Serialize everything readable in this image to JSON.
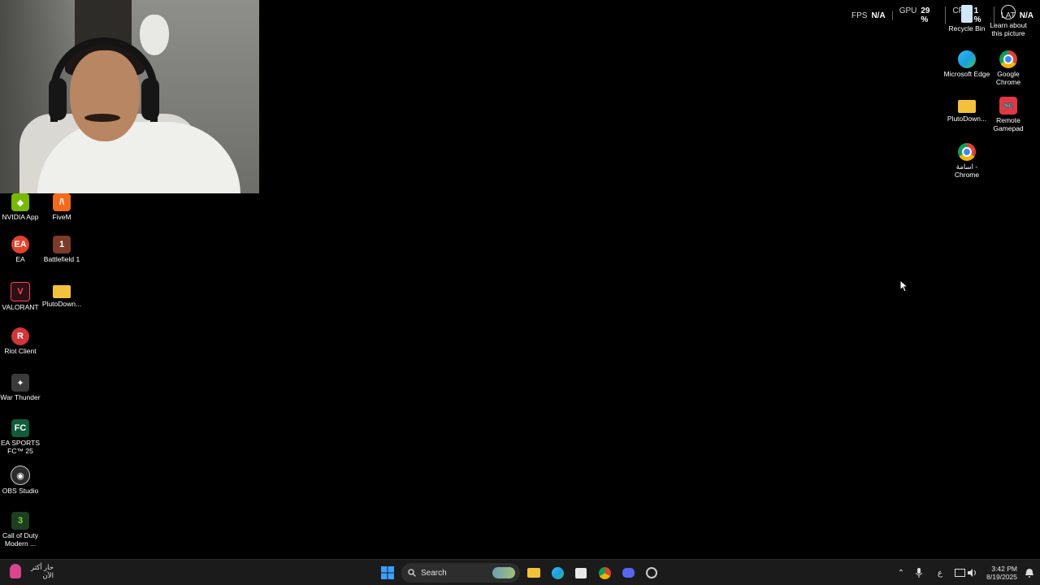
{
  "overlay": {
    "fps": {
      "key": "FPS",
      "value": "N/A"
    },
    "gpu": {
      "key": "GPU",
      "value": "29 %"
    },
    "cpu": {
      "key": "CPU",
      "value": "1 %"
    },
    "lat": {
      "key": "LAT",
      "value": "N/A"
    }
  },
  "desktop_icons": {
    "nvidia_app": "NVIDIA App",
    "fivem": "FiveM",
    "ea": "EA",
    "battlefield_1": "Battlefield 1",
    "valorant": "VALORANT",
    "pluto_left": "PlutoDown...",
    "riot_client": "Riot Client",
    "war_thunder": "War Thunder",
    "ea_sports_fc": "EA SPORTS FC™ 25",
    "obs_studio": "OBS Studio",
    "call_of_duty": "Call of Duty Modern ...",
    "recycle_bin": "Recycle Bin",
    "learn_picture": "Learn about this picture",
    "microsoft_edge": "Microsoft Edge",
    "google_chrome": "Google Chrome",
    "pluto_right": "PlutoDown...",
    "remote_gamepad": "Remote Gamepad",
    "osama_chrome": "اسامة - Chrome"
  },
  "taskbar": {
    "weather_text": "حار أكثر الآن",
    "search_label": "Search",
    "input_indicator": "ع",
    "time": "3:42 PM",
    "date": "8/19/2025"
  },
  "colors": {
    "desktop_bg": "#000000",
    "taskbar_bg": "#1b1b1c",
    "start_blue": "#3aa0ff"
  }
}
